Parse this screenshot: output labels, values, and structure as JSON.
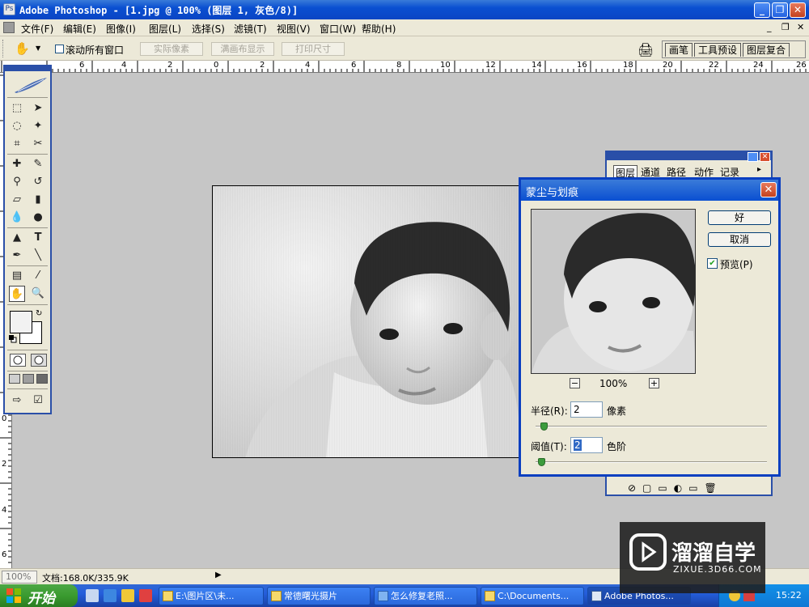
{
  "window": {
    "title": "Adobe Photoshop - [1.jpg @ 100% (图层 1, 灰色/8)]",
    "buttons": [
      "_",
      "❐",
      "✕"
    ]
  },
  "menu": [
    "文件(F)",
    "编辑(E)",
    "图像(I)",
    "图层(L)",
    "选择(S)",
    "滤镜(T)",
    "视图(V)",
    "窗口(W)",
    "帮助(H)"
  ],
  "options_bar": {
    "scroll_all_label": "滚动所有窗口",
    "actual_pixels": "实际像素",
    "fit_screen": "满画布显示",
    "print_size": "打印尺寸",
    "palette_tabs": [
      "画笔",
      "工具预设",
      "图层复合"
    ]
  },
  "rulers": {
    "top": [
      "6",
      "4",
      "2",
      "0",
      "2",
      "4",
      "6",
      "8",
      "10",
      "12",
      "14",
      "16",
      "18",
      "20",
      "22",
      "24",
      "26"
    ],
    "left": [
      "0",
      "2",
      "4",
      "6"
    ]
  },
  "layers_panel": {
    "tabs": [
      "图层",
      "通道",
      "路径",
      "动作",
      "记录"
    ]
  },
  "dialog": {
    "title": "蒙尘与划痕",
    "ok_label": "好",
    "cancel_label": "取消",
    "preview_label": "预览(P)",
    "preview_checked": true,
    "zoom": "100%",
    "zoom_minus": "−",
    "zoom_plus": "+",
    "radius_label": "半径(R):",
    "radius_value": "2",
    "radius_unit": "像素",
    "radius_slider": 0.02,
    "threshold_label": "阈值(T):",
    "threshold_value": "2",
    "threshold_unit": "色阶",
    "threshold_slider": 0.01
  },
  "status": {
    "zoom": "100%",
    "doc_info": "文档:168.0K/335.9K"
  },
  "taskbar": {
    "start": "开始",
    "tasks": [
      "E:\\图片区\\未...",
      "常德曙光摄片",
      "怎么修复老照...",
      "C:\\Documents...",
      "Adobe Photos..."
    ],
    "clock": "15:22"
  },
  "watermark": {
    "name": "溜溜自学",
    "url": "ZIXUE.3D66.COM"
  },
  "colors": {
    "xp_blue": "#0a4fd1",
    "xp_beige": "#ece9d8",
    "start_green": "#3a9b30",
    "workspace_gray": "#c6c6c6"
  }
}
